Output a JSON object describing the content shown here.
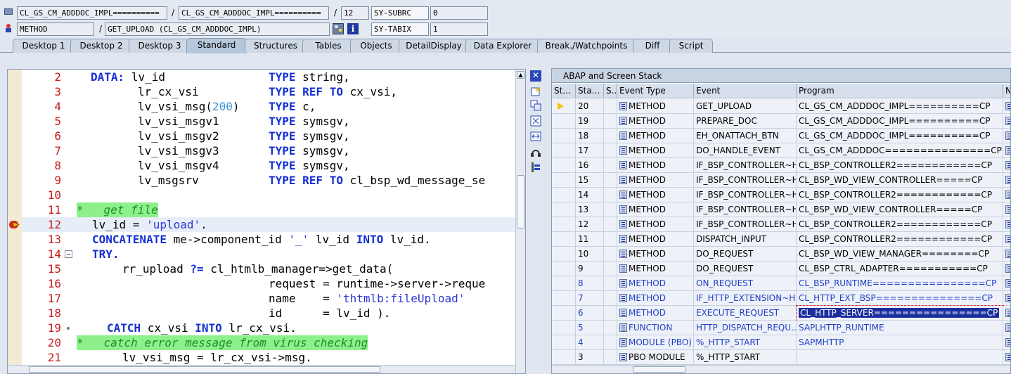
{
  "header": {
    "row1": {
      "prog1": "CL_GS_CM_ADDDOC_IMPL==========",
      "slash1": "/",
      "prog2": "CL_GS_CM_ADDDOC_IMPL==========",
      "slash2": "/",
      "line_no": "12",
      "sys_var1": "SY-SUBRC",
      "sys_val1": "0"
    },
    "row2": {
      "type": "METHOD",
      "slash": "/",
      "name": "GET_UPLOAD (CL_GS_CM_ADDDOC_IMPL)",
      "sys_var2": "SY-TABIX",
      "sys_val2": "1"
    }
  },
  "tabs": [
    {
      "label": "Desktop 1"
    },
    {
      "label": "Desktop 2"
    },
    {
      "label": "Desktop 3"
    },
    {
      "label": "Standard",
      "active": true
    },
    {
      "label": "Structures"
    },
    {
      "label": "Tables"
    },
    {
      "label": "Objects"
    },
    {
      "label": "DetailDisplay"
    },
    {
      "label": "Data Explorer"
    },
    {
      "label": "Break./Watchpoints"
    },
    {
      "label": "Diff"
    },
    {
      "label": "Script"
    }
  ],
  "code": {
    "line_numbers": [
      "2",
      "3",
      "4",
      "5",
      "6",
      "7",
      "8",
      "9",
      "10",
      "11",
      "12",
      "13",
      "14",
      "15",
      "16",
      "17",
      "18",
      "19",
      "20",
      "21"
    ],
    "lines": {
      "l2_kw": "DATA:",
      "l2_var": "lv_id",
      "l2_type": "TYPE",
      "l2_t": "string,",
      "l3_var": "lr_cx_vsi",
      "l3_type": "TYPE REF TO",
      "l3_t": "cx_vsi,",
      "l4_var": "lv_vsi_msg(",
      "l4_num": "200",
      "l4_close": ")",
      "l4_type": "TYPE",
      "l4_t": "c,",
      "l5_var": "lv_vsi_msgv1",
      "l5_type": "TYPE",
      "l5_t": "symsgv,",
      "l6_var": "lv_vsi_msgv2",
      "l6_type": "TYPE",
      "l6_t": "symsgv,",
      "l7_var": "lv_vsi_msgv3",
      "l7_type": "TYPE",
      "l7_t": "symsgv,",
      "l8_var": "lv_vsi_msgv4",
      "l8_type": "TYPE",
      "l8_t": "symsgv,",
      "l9_var": "lv_msgsrv",
      "l9_type": "TYPE REF TO",
      "l9_t": "cl_bsp_wd_message_se",
      "l11_comment": "*   get file",
      "l12_a": "lv_id = ",
      "l12_s": "'upload'",
      "l12_b": ".",
      "l13_kw": "CONCATENATE",
      "l13_a": " me->component_id ",
      "l13_s": "'_'",
      "l13_b": " lv_id ",
      "l13_kw2": "INTO",
      "l13_c": " lv_id.",
      "l14_kw": "TRY.",
      "l15_a": "rr_upload ",
      "l15_op": "?=",
      "l15_b": " cl_htmlb_manager=>get_data(",
      "l16_a": "request = runtime->server->reque",
      "l17_a": "name    = ",
      "l17_s": "'thtmlb:fileUpload'",
      "l18_a": "id      = lv_id ).",
      "l19_kw": "CATCH",
      "l19_a": " cx_vsi ",
      "l19_kw2": "INTO",
      "l19_b": " lr_cx_vsi.",
      "l20_comment": "*   catch error message from virus checking",
      "l21_a": "lv_vsi_msg = lr_cx_vsi->msg."
    }
  },
  "stack": {
    "title": "ABAP and Screen Stack",
    "columns": [
      "St...",
      "Sta...",
      "S...",
      "Event Type",
      "Event",
      "Program",
      "Na"
    ],
    "rows": [
      {
        "level": "20",
        "event_type": "METHOD",
        "event": "GET_UPLOAD",
        "program": "CL_GS_CM_ADDDOC_IMPL==========CP",
        "current": true
      },
      {
        "level": "19",
        "event_type": "METHOD",
        "event": "PREPARE_DOC",
        "program": "CL_GS_CM_ADDDOC_IMPL==========CP"
      },
      {
        "level": "18",
        "event_type": "METHOD",
        "event": "EH_ONATTACH_BTN",
        "program": "CL_GS_CM_ADDDOC_IMPL==========CP"
      },
      {
        "level": "17",
        "event_type": "METHOD",
        "event": "DO_HANDLE_EVENT",
        "program": "CL_GS_CM_ADDDOC===============CP"
      },
      {
        "level": "16",
        "event_type": "METHOD",
        "event": "IF_BSP_CONTROLLER~H...",
        "program": "CL_BSP_CONTROLLER2============CP"
      },
      {
        "level": "15",
        "event_type": "METHOD",
        "event": "IF_BSP_CONTROLLER~H...",
        "program": "CL_BSP_WD_VIEW_CONTROLLER=====CP"
      },
      {
        "level": "14",
        "event_type": "METHOD",
        "event": "IF_BSP_CONTROLLER~H...",
        "program": "CL_BSP_CONTROLLER2============CP"
      },
      {
        "level": "13",
        "event_type": "METHOD",
        "event": "IF_BSP_CONTROLLER~H...",
        "program": "CL_BSP_WD_VIEW_CONTROLLER=====CP"
      },
      {
        "level": "12",
        "event_type": "METHOD",
        "event": "IF_BSP_CONTROLLER~H...",
        "program": "CL_BSP_CONTROLLER2============CP"
      },
      {
        "level": "11",
        "event_type": "METHOD",
        "event": "DISPATCH_INPUT",
        "program": "CL_BSP_CONTROLLER2============CP"
      },
      {
        "level": "10",
        "event_type": "METHOD",
        "event": "DO_REQUEST",
        "program": "CL_BSP_WD_VIEW_MANAGER========CP"
      },
      {
        "level": "9",
        "event_type": "METHOD",
        "event": "DO_REQUEST",
        "program": "CL_BSP_CTRL_ADAPTER===========CP"
      },
      {
        "level": "8",
        "event_type": "METHOD",
        "event": "ON_REQUEST",
        "program": "CL_BSP_RUNTIME================CP",
        "blue": true
      },
      {
        "level": "7",
        "event_type": "METHOD",
        "event": "IF_HTTP_EXTENSION~H...",
        "program": "CL_HTTP_EXT_BSP===============CP",
        "blue": true
      },
      {
        "level": "6",
        "event_type": "METHOD",
        "event": "EXECUTE_REQUEST",
        "program": "CL_HTTP_SERVER================CP",
        "blue": true,
        "selected": true
      },
      {
        "level": "5",
        "event_type": "FUNCTION",
        "event": "HTTP_DISPATCH_REQU...",
        "program": "SAPLHTTP_RUNTIME",
        "blue": true
      },
      {
        "level": "4",
        "event_type": "MODULE (PBO)",
        "event": "%_HTTP_START",
        "program": "SAPMHTTP",
        "blue": true
      },
      {
        "level": "3",
        "event_type": "PBO MODULE",
        "event": "%_HTTP_START",
        "program": ""
      }
    ]
  },
  "colors": {
    "keyword": "#1630d4",
    "comment_bg": "#8df08b",
    "line_number": "#c71b1b",
    "selection": "#1a2e9e"
  }
}
